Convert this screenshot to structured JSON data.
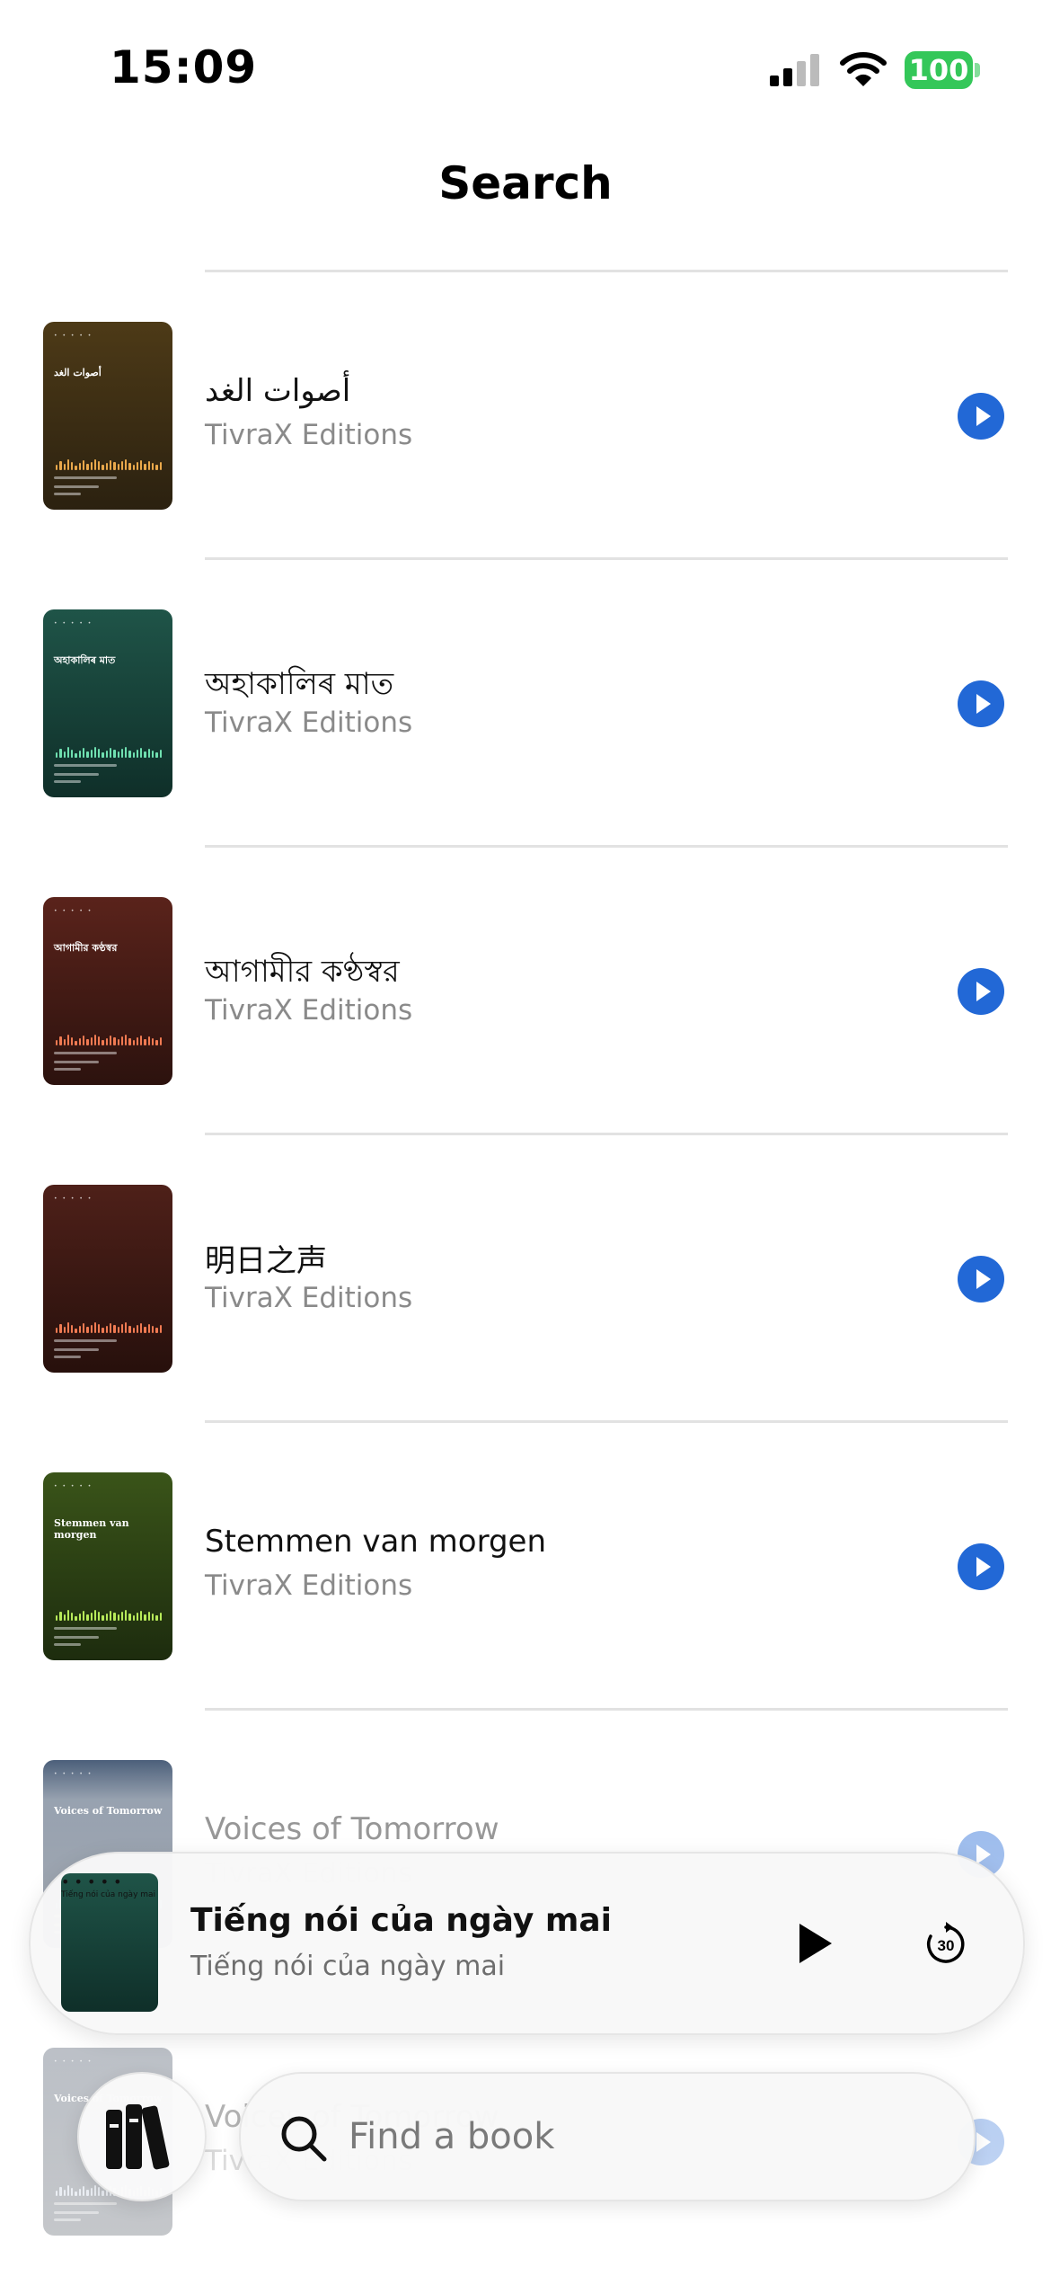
{
  "status_bar": {
    "time": "15:09",
    "battery": "100"
  },
  "header": {
    "title": "Search"
  },
  "books": [
    {
      "title": "أصوات الغد",
      "author": "TivraX Editions",
      "cover_title": "أصوات الغد",
      "cover_top": "#4d3a17",
      "cover_bottom": "#2b2110",
      "bar_color": "#e9a84b"
    },
    {
      "title": "অহাকালিৰ মাত",
      "author": "TivraX Editions",
      "cover_title": "অহাকালিৰ মাত",
      "cover_top": "#1f5448",
      "cover_bottom": "#0f2f29",
      "bar_color": "#6fe0b0"
    },
    {
      "title": "আগামীর কণ্ঠস্বর",
      "author": "TivraX Editions",
      "cover_title": "আগামীর কণ্ঠস্বর",
      "cover_top": "#5a231b",
      "cover_bottom": "#2c120e",
      "bar_color": "#f07a52"
    },
    {
      "title": "明日之声",
      "author": "TivraX Editions",
      "cover_title": "",
      "cover_top": "#4e2019",
      "cover_bottom": "#27100c",
      "bar_color": "#f07a52"
    },
    {
      "title": "Stemmen van morgen",
      "author": "TivraX Editions",
      "cover_title": "Stemmen van morgen",
      "cover_top": "#3a5419",
      "cover_bottom": "#1d2c0e",
      "bar_color": "#b7ea5a"
    },
    {
      "title": "Voices of Tomorrow",
      "author": "TivraX Editions",
      "cover_title": "Voices of Tomorrow",
      "cover_top": "#1c3557",
      "cover_bottom": "#0f1f36",
      "bar_color": "#6ab0f0"
    },
    {
      "title": "Voices of Tomorrow",
      "author": "TivraX Editions",
      "cover_title": "Voices of Tomorrow",
      "cover_top": "#3d4a5e",
      "cover_bottom": "#252e3b",
      "bar_color": "#b9c6d8"
    }
  ],
  "now_playing": {
    "title": "Tiếng nói của ngày mai",
    "subtitle": "Tiếng nói của ngày mai",
    "cover_title": "Tiếng nói của ngày mai",
    "skip_seconds": "30",
    "cover_top": "#1f5448",
    "cover_bottom": "#0f2f29",
    "bar_color": "#6fe0b0"
  },
  "search": {
    "placeholder": "Find a book",
    "value": ""
  },
  "colors": {
    "accent": "#2268d6",
    "battery": "#34c759"
  }
}
